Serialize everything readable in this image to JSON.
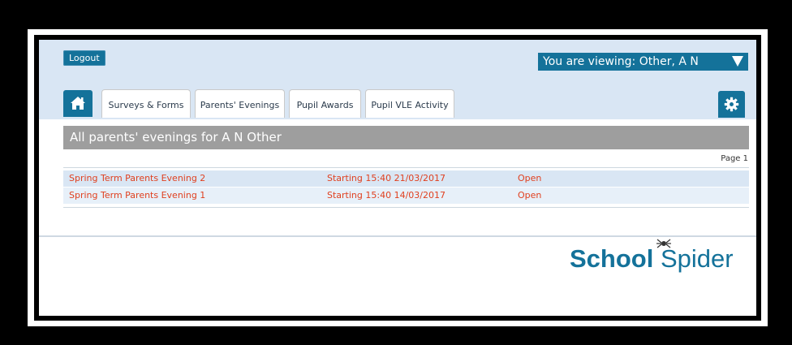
{
  "header": {
    "logout_label": "Logout",
    "viewing_label": "You are viewing: Other, A N"
  },
  "tabs": [
    {
      "label": "Surveys & Forms"
    },
    {
      "label": "Parents' Evenings"
    },
    {
      "label": "Pupil Awards"
    },
    {
      "label": "Pupil VLE Activity"
    }
  ],
  "section": {
    "title": "All parents' evenings for A N Other",
    "page_label": "Page 1"
  },
  "evenings": [
    {
      "name": "Spring Term Parents Evening 2",
      "start": "Starting 15:40 21/03/2017",
      "status": "Open"
    },
    {
      "name": "Spring Term Parents Evening 1",
      "start": "Starting 15:40 14/03/2017",
      "status": "Open"
    }
  ],
  "footer": {
    "logo_bold": "School",
    "logo_light": "Spider"
  },
  "icons": {
    "home": "home-icon",
    "settings": "gear-icon",
    "dropdown": "triangle-down-icon"
  },
  "colors": {
    "accent": "#14729a",
    "header_bg": "#d9e6f4",
    "link": "#e0401f",
    "section_bar": "#9e9e9e"
  }
}
